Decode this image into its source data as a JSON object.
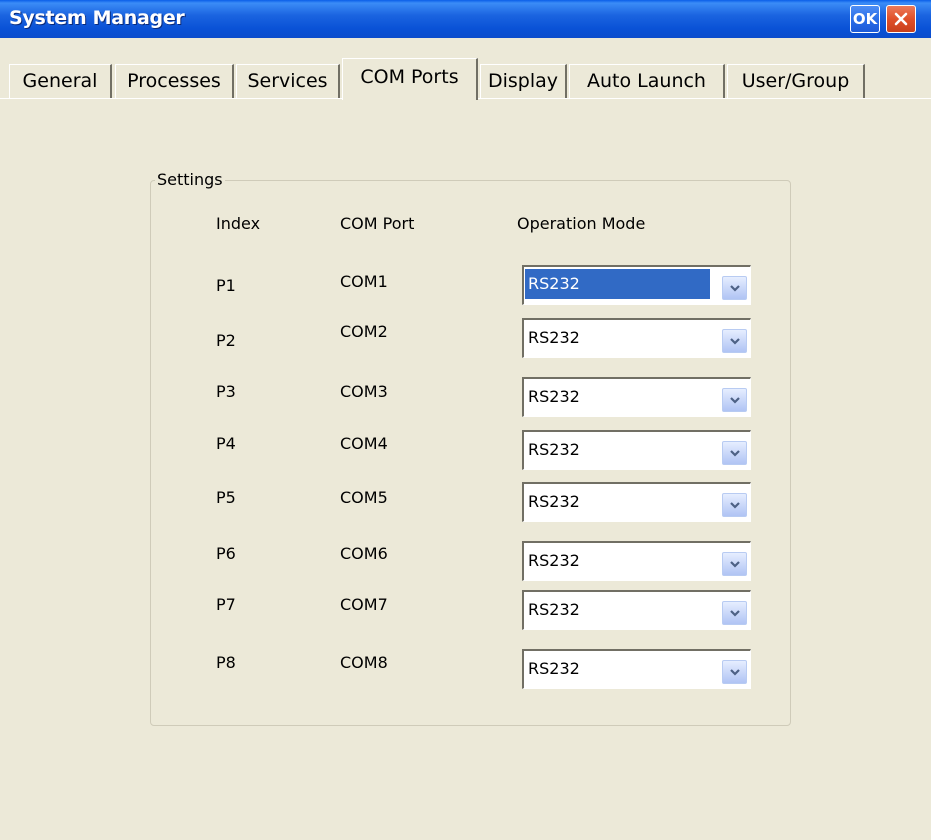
{
  "window": {
    "title": "System Manager",
    "ok_label": "OK",
    "close_icon": "close-icon"
  },
  "tabs": [
    {
      "label": "General",
      "active": false
    },
    {
      "label": "Processes",
      "active": false
    },
    {
      "label": "Services",
      "active": false
    },
    {
      "label": "COM Ports",
      "active": true
    },
    {
      "label": "Display",
      "active": false
    },
    {
      "label": "Auto Launch",
      "active": false
    },
    {
      "label": "User/Group",
      "active": false
    }
  ],
  "settings": {
    "group_label": "Settings",
    "headers": {
      "index": "Index",
      "com_port": "COM Port",
      "operation_mode": "Operation Mode"
    },
    "rows": [
      {
        "index": "P1",
        "com_port": "COM1",
        "mode": "RS232",
        "selected": true
      },
      {
        "index": "P2",
        "com_port": "COM2",
        "mode": "RS232",
        "selected": false
      },
      {
        "index": "P3",
        "com_port": "COM3",
        "mode": "RS232",
        "selected": false
      },
      {
        "index": "P4",
        "com_port": "COM4",
        "mode": "RS232",
        "selected": false
      },
      {
        "index": "P5",
        "com_port": "COM5",
        "mode": "RS232",
        "selected": false
      },
      {
        "index": "P6",
        "com_port": "COM6",
        "mode": "RS232",
        "selected": false
      },
      {
        "index": "P7",
        "com_port": "COM7",
        "mode": "RS232",
        "selected": false
      },
      {
        "index": "P8",
        "com_port": "COM8",
        "mode": "RS232",
        "selected": false
      }
    ]
  },
  "colors": {
    "titlebar_blue": "#0a52d6",
    "selection_blue": "#316ac5",
    "window_bg": "#ece9d8",
    "close_red": "#e0502a"
  }
}
